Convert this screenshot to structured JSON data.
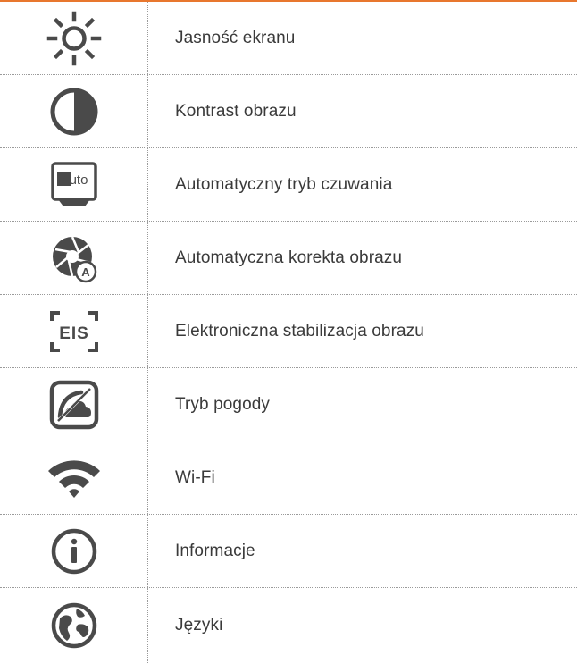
{
  "accent_color": "#e8772e",
  "icon_color": "#4a4a4a",
  "rows": [
    {
      "icon": "sun-brightness-icon",
      "label": "Jasność ekranu"
    },
    {
      "icon": "contrast-icon",
      "label": "Kontrast obrazu"
    },
    {
      "icon": "auto-standby-monitor-icon",
      "icon_text": "Auto",
      "label": "Automatyczny tryb czuwania"
    },
    {
      "icon": "aperture-auto-correction-icon",
      "icon_text": "A",
      "label": "Automatyczna korekta obrazu"
    },
    {
      "icon": "eis-stabilization-icon",
      "icon_text": "EIS",
      "label": "Elektroniczna stabilizacja obrazu"
    },
    {
      "icon": "weather-mode-icon",
      "label": "Tryb pogody"
    },
    {
      "icon": "wifi-icon",
      "label": "Wi-Fi"
    },
    {
      "icon": "info-icon",
      "label": "Informacje"
    },
    {
      "icon": "globe-language-icon",
      "label": "Języki"
    }
  ]
}
